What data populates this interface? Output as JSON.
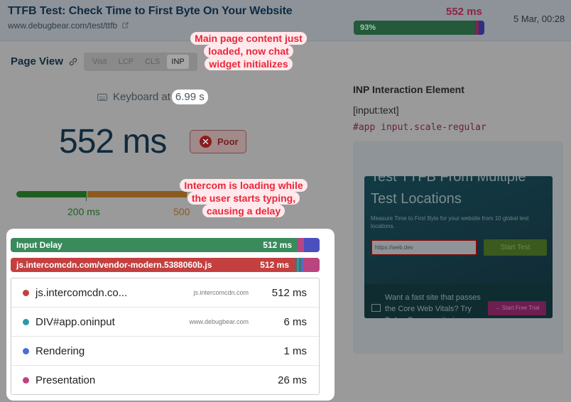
{
  "header": {
    "title": "TTFB Test: Check Time to First Byte On Your Website",
    "url": "www.debugbear.com/test/ttfb",
    "inp_value": "552 ms",
    "progress_label": "93%",
    "progress_fraction": 0.93,
    "date": "5 Mar, 00:28"
  },
  "page_view": {
    "title": "Page View",
    "tabs": [
      {
        "label": "Visit",
        "active": false
      },
      {
        "label": "LCP",
        "active": false
      },
      {
        "label": "CLS",
        "active": false
      },
      {
        "label": "INP",
        "active": true
      }
    ],
    "interaction_label": "Keyboard at",
    "interaction_time": "6.99 s",
    "metric_value": "552 ms",
    "rating": "Poor",
    "thresholds": [
      "200 ms",
      "500"
    ]
  },
  "annotations": {
    "top": [
      "Main page content just",
      "loaded, now chat",
      "widget initializes"
    ],
    "middle": [
      "Intercom is loading while",
      "the user starts typing,",
      "causing a delay"
    ]
  },
  "breakdown": {
    "input_delay": {
      "label": "Input Delay",
      "value": "512 ms"
    },
    "script": {
      "label": "js.intercomcdn.com/vendor-modern.5388060b.js",
      "value": "512 ms"
    },
    "rows": [
      {
        "name": "js.intercomcdn.co...",
        "domain": "js.intercomcdn.com",
        "value": "512 ms",
        "color": "#c43f3f"
      },
      {
        "name": "DIV#app.oninput",
        "domain": "www.debugbear.com",
        "value": "6 ms",
        "color": "#2a9aaa"
      },
      {
        "name": "Rendering",
        "domain": "",
        "value": "1 ms",
        "color": "#4a70d0"
      },
      {
        "name": "Presentation",
        "domain": "",
        "value": "26 ms",
        "color": "#b94580"
      }
    ]
  },
  "interaction_element": {
    "title": "INP Interaction Element",
    "selector": "[input:text]",
    "css_path": "#app input.scale-regular",
    "screenshot": {
      "heading_line1": "Test TTFB From Multiple",
      "heading_line2": "Test Locations",
      "description": "Measure Time to First Byte for your website from 10 global test locations.",
      "url_input": "https://web.dev",
      "start_button": "Start Test",
      "promo": "Want a fast site that passes the Core Web Vitals? Try DebugBear monitoring",
      "trial_button": "→ Start Free Trial"
    }
  }
}
